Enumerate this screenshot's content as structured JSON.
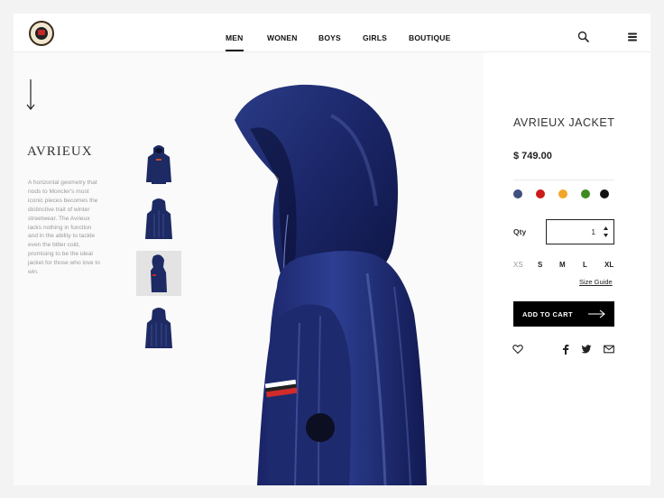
{
  "header": {
    "logo_icon": "moncler-logo",
    "nav": [
      {
        "label": "MEN",
        "active": true
      },
      {
        "label": "WONEN",
        "active": false
      },
      {
        "label": "BOYS",
        "active": false
      },
      {
        "label": "GIRLS",
        "active": false
      },
      {
        "label": "BOUTIQUE",
        "active": false
      }
    ],
    "search_icon": "search-icon",
    "menu_icon": "menu-icon"
  },
  "product_intro": {
    "name": "AVRIEUX",
    "description": "A horizontal geometry that nods to Moncler's most iconic pieces becomes the distinctive trait of winter streetwear. The Avrieux lacks nothing in function and in the ability to tackle even the bitter cold, promising to be the ideal jacket for those who love to win.",
    "scroll_icon": "arrow-down-icon",
    "thumbnails": [
      {
        "view": "front",
        "selected": false
      },
      {
        "view": "back",
        "selected": false
      },
      {
        "view": "side",
        "selected": true
      },
      {
        "view": "back-full",
        "selected": false
      }
    ]
  },
  "product": {
    "title": "AVRIEUX JACKET",
    "price": "$ 749.00",
    "colors": [
      "#3e4f80",
      "#cc1a1a",
      "#f3a52a",
      "#3e8a21",
      "#111111"
    ],
    "qty_label": "Qty",
    "qty_value": "1",
    "sizes": [
      {
        "label": "XS",
        "available": false
      },
      {
        "label": "S",
        "available": true
      },
      {
        "label": "M",
        "available": true
      },
      {
        "label": "L",
        "available": true
      },
      {
        "label": "XL",
        "available": true
      }
    ],
    "size_guide": "Size Guide",
    "add_to_cart": "ADD TO CART",
    "icons": [
      "heart-icon",
      "facebook-icon",
      "twitter-icon",
      "mail-icon"
    ]
  }
}
